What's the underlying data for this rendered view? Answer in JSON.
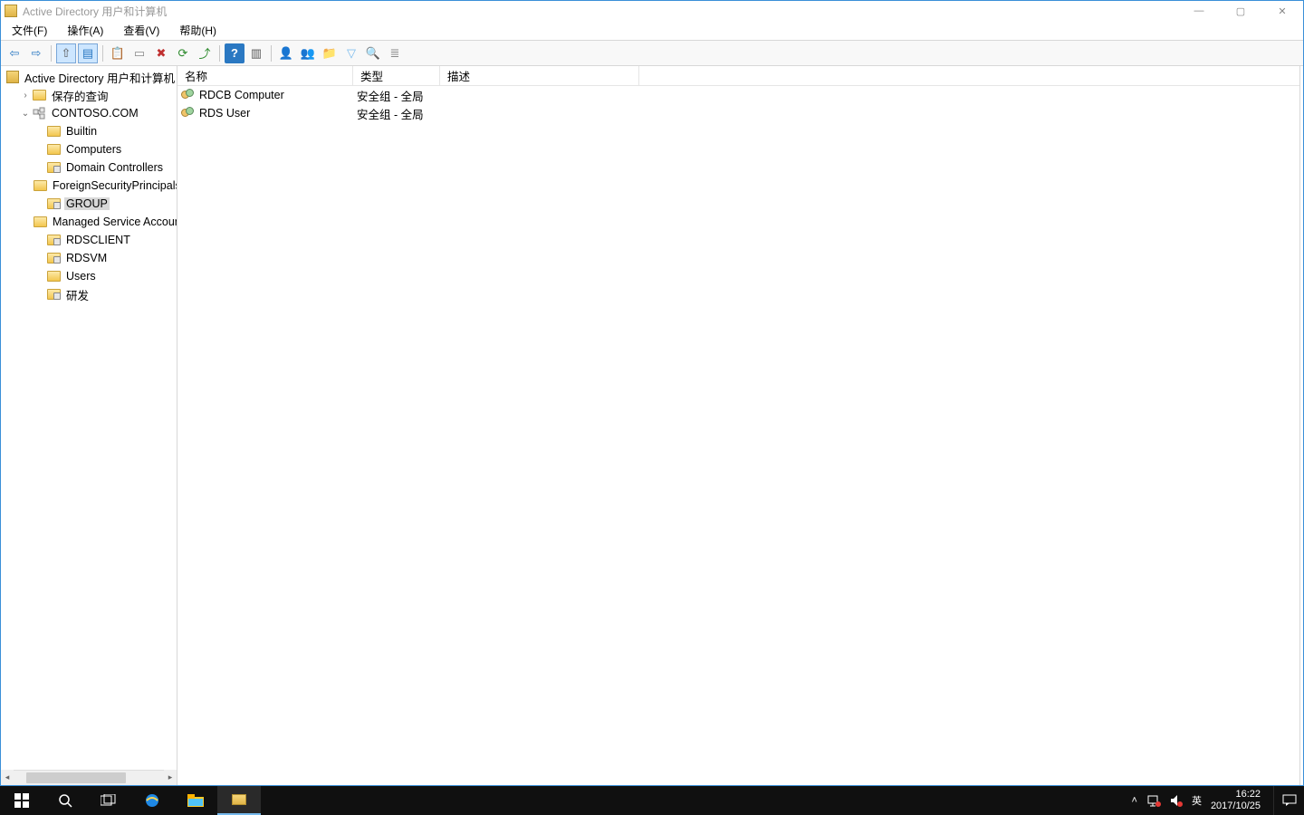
{
  "window": {
    "title": "Active Directory 用户和计算机",
    "controls": {
      "min": "—",
      "max": "▢",
      "close": "✕"
    }
  },
  "menu": {
    "file": "文件(F)",
    "action": "操作(A)",
    "view": "查看(V)",
    "help": "帮助(H)"
  },
  "toolbar": [
    {
      "name": "back-icon",
      "glyph": "⇦",
      "color": "#2a78c2"
    },
    {
      "name": "forward-icon",
      "glyph": "⇨",
      "color": "#2a78c2"
    },
    {
      "sep": true
    },
    {
      "name": "up-icon",
      "glyph": "⇧",
      "color": "#555",
      "pressed": true
    },
    {
      "name": "show-hide-icon",
      "glyph": "▤",
      "color": "#2a78c2",
      "pressed": true
    },
    {
      "sep": true
    },
    {
      "name": "cut-icon",
      "glyph": "📋",
      "color": "#888"
    },
    {
      "name": "properties-icon",
      "glyph": "▭",
      "color": "#888"
    },
    {
      "name": "delete-icon",
      "glyph": "✖",
      "color": "#c03030"
    },
    {
      "name": "refresh-icon",
      "glyph": "⟳",
      "color": "#2d8a2d"
    },
    {
      "name": "export-icon",
      "glyph": "⤴",
      "color": "#2d8a2d"
    },
    {
      "sep": true
    },
    {
      "name": "help-icon",
      "glyph": "?",
      "color": "#fff",
      "bg": "#2a78c2"
    },
    {
      "name": "tree-icon",
      "glyph": "▥",
      "color": "#555"
    },
    {
      "sep": true
    },
    {
      "name": "user-icon",
      "glyph": "👤",
      "color": "#76b9ed"
    },
    {
      "name": "group-icon",
      "glyph": "👥",
      "color": "#76b9ed"
    },
    {
      "name": "ou-icon",
      "glyph": "📁",
      "color": "#d7a93b"
    },
    {
      "name": "filter-icon",
      "glyph": "▽",
      "color": "#76b9ed"
    },
    {
      "name": "find-icon",
      "glyph": "🔍",
      "color": "#555"
    },
    {
      "name": "add-criteria-icon",
      "glyph": "≣",
      "color": "#888"
    }
  ],
  "tree": {
    "root": {
      "label": "Active Directory 用户和计算机",
      "icon": "app",
      "indent": 0,
      "expander": ""
    },
    "savedQueries": {
      "label": "保存的查询",
      "icon": "folder",
      "indent": 1,
      "expander": "›"
    },
    "domain": {
      "label": "CONTOSO.COM",
      "icon": "domain",
      "indent": 1,
      "expander": "⌄"
    },
    "children": [
      {
        "label": "Builtin",
        "icon": "folder"
      },
      {
        "label": "Computers",
        "icon": "folder"
      },
      {
        "label": "Domain Controllers",
        "icon": "ou"
      },
      {
        "label": "ForeignSecurityPrincipals",
        "icon": "folder"
      },
      {
        "label": "GROUP",
        "icon": "ou",
        "selected": true
      },
      {
        "label": "Managed Service Accounts",
        "icon": "folder"
      },
      {
        "label": "RDSCLIENT",
        "icon": "ou"
      },
      {
        "label": "RDSVM",
        "icon": "ou"
      },
      {
        "label": "Users",
        "icon": "folder"
      },
      {
        "label": "研发",
        "icon": "ou"
      }
    ]
  },
  "list": {
    "columns": {
      "name": "名称",
      "type": "类型",
      "desc": "描述"
    },
    "widths": {
      "name": 194,
      "type": 96,
      "desc": 220
    },
    "rows": [
      {
        "name": "RDCB Computer",
        "type": "安全组 - 全局",
        "desc": ""
      },
      {
        "name": "RDS User",
        "type": "安全组 - 全局",
        "desc": ""
      }
    ]
  },
  "taskbar": {
    "ime": "英",
    "time": "16:22",
    "date": "2017/10/25"
  }
}
